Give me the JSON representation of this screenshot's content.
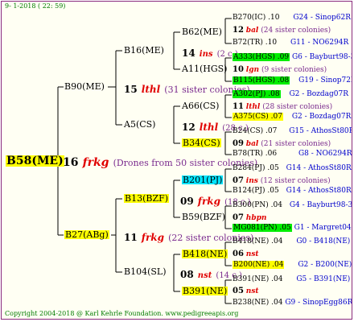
{
  "header": {
    "date_line": "9-  1-2018 ( 22: 59)"
  },
  "footer": {
    "copyright": "Copyright 2004-2018 @ Karl Kehrle Foundation.   www.pedigreeapis.org"
  },
  "root": {
    "name": "B58(ME)",
    "num": "16",
    "frkg": "frkg",
    "note": "(Drones from 50 sister colonies)"
  },
  "gen1": {
    "top": {
      "name": "B90(ME)",
      "num": "15",
      "frkg": "lthl",
      "note": "(31 sister colonies)"
    },
    "bottom": {
      "name": "B27(ABg)",
      "num": "11",
      "frkg": "frkg",
      "note": "(22 sister colonies)"
    }
  },
  "gen2": {
    "a": {
      "name": "B16(ME)",
      "num": "14",
      "frkg": "ins",
      "note": "(2 c.)"
    },
    "b": {
      "name": "A5(CS)",
      "num": "12",
      "frkg": "lthl",
      "note": "(28 c.)"
    },
    "c": {
      "name": "B13(BZF)",
      "num": "09",
      "frkg": "frkg",
      "note": "(18 c.)"
    },
    "d": {
      "name": "B104(SL)",
      "num": "08",
      "frkg": "nst",
      "note": "(14 c.)"
    }
  },
  "gen3": {
    "a": {
      "name": "B62(ME)"
    },
    "b": {
      "name": "A11(HGS)"
    },
    "c": {
      "name": "A66(CS)"
    },
    "d": {
      "name": "B34(CS)"
    },
    "e": {
      "name": "B201(PJ)"
    },
    "f": {
      "name": "B59(BZF)"
    },
    "g": {
      "name": "B418(NE)"
    },
    "h": {
      "name": "B391(NE)"
    }
  },
  "gen4": [
    {
      "top_name": "B270(IC)",
      "top_val": ".10",
      "top_code": "G24 - Sinop62R",
      "mid_num": "12",
      "mid_frkg": "bal",
      "mid_note": "(24 sister colonies)",
      "bot_name": "B72(TR)",
      "bot_val": ".10",
      "bot_code": "G11 - NO6294R"
    },
    {
      "top_name": "A333(HGS)",
      "top_val": ".09",
      "top_code": "G6 - Bayburt98-3",
      "mid_num": "10",
      "mid_frkg": "lgn",
      "mid_note": "(9 sister colonies)",
      "bot_name": "B115(HGS)",
      "bot_val": ".08",
      "bot_code": "G19 - Sinop72R"
    },
    {
      "top_name": "A302(PJ)",
      "top_val": ".08",
      "top_code": "G2 - Bozdag07R",
      "mid_num": "11",
      "mid_frkg": "lthl",
      "mid_note": "(28 sister colonies)",
      "bot_name": "A375(CS)",
      "bot_val": ".07",
      "bot_code": "G2 - Bozdag07R"
    },
    {
      "top_name": "B24(CS)",
      "top_val": ".07",
      "top_code": "G15 - AthosSt80R",
      "mid_num": "09",
      "mid_frkg": "bal",
      "mid_note": "(21 sister colonies)",
      "bot_name": "B78(TR)",
      "bot_val": ".06",
      "bot_code": "G8 - NO6294R"
    },
    {
      "top_name": "B284(PJ)",
      "top_val": ".05",
      "top_code": "G14 - AthosSt80R",
      "mid_num": "07",
      "mid_frkg": "ins",
      "mid_note": "(12 sister colonies)",
      "bot_name": "B124(PJ)",
      "bot_val": ".05",
      "bot_code": "G14 - AthosSt80R"
    },
    {
      "top_name": "B300(PN)",
      "top_val": ".04",
      "top_code": "G4 - Bayburt98-3",
      "mid_num": "07",
      "mid_frkg": "hbpn",
      "mid_note": "",
      "bot_name": "MG081(PN)",
      "bot_val": ".05",
      "bot_code": "G1 - Margret04R"
    },
    {
      "top_name": "B418(NE)",
      "top_val": ".04",
      "top_code": "G0 - B418(NE)",
      "mid_num": "06",
      "mid_frkg": "nst",
      "mid_note": "",
      "bot_name": "B200(NE)",
      "bot_val": ".04",
      "bot_code": "G2 - B200(NE)"
    },
    {
      "top_name": "B391(NE)",
      "top_val": ".04",
      "top_code": "G5 - B391(NE)",
      "mid_num": "05",
      "mid_frkg": "nst",
      "mid_note": "",
      "bot_name": "B238(NE)",
      "bot_val": ".04",
      "bot_code": "G9 - SinopEgg86R"
    }
  ]
}
